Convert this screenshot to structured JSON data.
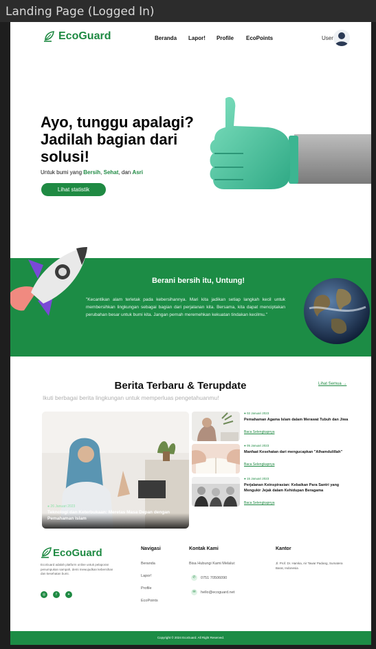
{
  "frame": {
    "title": "Landing Page (Logged In)"
  },
  "brand": {
    "name": "EcoGuard",
    "color": "#1f8a43"
  },
  "nav": {
    "links": [
      "Beranda",
      "Lapor!",
      "Profile",
      "EcoPoints"
    ],
    "user_label": "User"
  },
  "hero": {
    "title": "Ayo, tunggu apalagi? Jadilah bagian dari solusi!",
    "sub_prefix": "Untuk bumi yang ",
    "w1": "Bersih",
    "sep1": ", ",
    "w2": "Sehat",
    "sep2": ", dan ",
    "w3": "Asri",
    "button": "Lihat statistik"
  },
  "band": {
    "title": "Berani bersih itu, Untung!",
    "quote": "\"Kecantikan alam terletak pada kebersihannya. Mari kita jadikan setiap langkah kecil untuk membersihkan lingkungan sebagai bagian dari perjalanan kita. Bersama, kita dapat menciptakan perubahan besar untuk bumi kita. Jangan pernah meremehkan kekuatan tindakan kecilmu.\""
  },
  "news": {
    "title": "Berita Terbaru & Terupdate",
    "see_all": "Lihat Semua →",
    "subtitle": "Ikuti berbagai berita lingkungan untuk memperluas pengetahuanmu!",
    "feature": {
      "date": "● 26 Januari 2023",
      "title": "Teknologi dan Keterbukaan: Meretas Masa Depan dengan Pemahaman Islam"
    },
    "items": [
      {
        "date": "● 02 Januari 2023",
        "title": "Pemahaman Agama Islam dalam Merawat Tubuh dan Jiwa",
        "link": "Baca Selengkapnya"
      },
      {
        "date": "● 05 Januari 2023",
        "title": "Manfaat Kesehatan dari mengucapkan \"Alhamdulillah\"",
        "link": "Baca Selengkapnya"
      },
      {
        "date": "● 15 Januari 2023",
        "title": "Perjalanan Keinspirasian: Kebaikan Para Santri yang Mengukir Jejak dalam Kehidupan Beragama",
        "link": "Baca Selengkapnya"
      }
    ]
  },
  "footer": {
    "description": "EcoGuard adalah platform online untuk pelaporan penumpukan sampah, demi mewujudkan kebersihan dan kesehatan bumi.",
    "nav_heading": "Navigasi",
    "nav_items": [
      "Beranda",
      "Lapor!",
      "Profile",
      "EcoPoints"
    ],
    "contact_heading": "Kontak Kami",
    "contact_intro": "Bisa Hubungi Kami Melalui:",
    "phone": "0751 70506090",
    "email": "hello@ecoguard.net",
    "office_heading": "Kantor",
    "office_address": "Jl. Prof. Dr. Hamka, Air Tawar Padang, Sumatera Barat, Indonesia",
    "copyright": "Copyright © 2024 EcoGuard. All Right Reserved."
  }
}
